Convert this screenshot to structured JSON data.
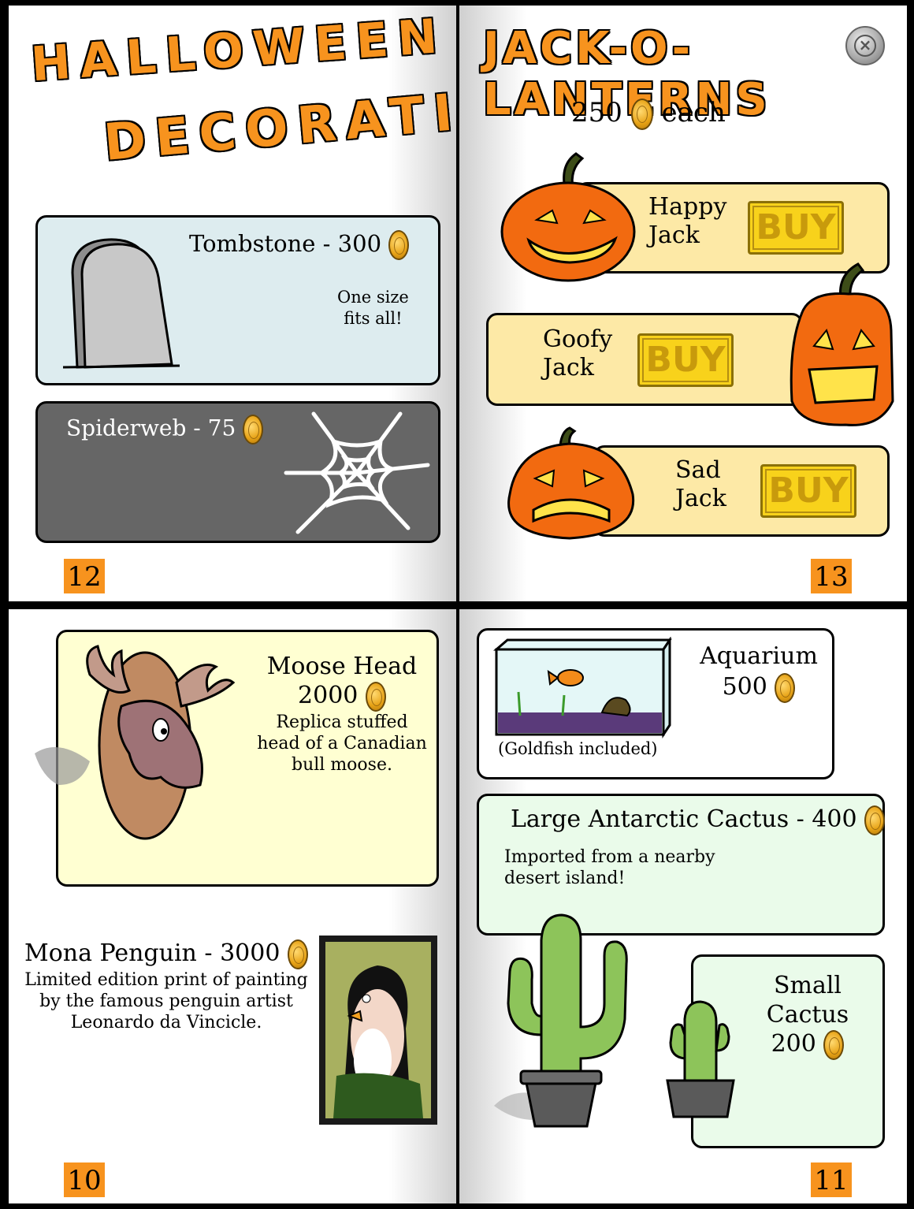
{
  "page12": {
    "title_line1": "HALLOWEEN",
    "title_line2": "DECORATIONS",
    "tombstone": {
      "name": "Tombstone - 300",
      "desc_line1": "One size",
      "desc_line2": "fits all!"
    },
    "spiderweb": {
      "name": "Spiderweb - 75"
    },
    "page_number": "12"
  },
  "page13": {
    "title": "JACK-O-LANTERNS",
    "price": "250",
    "price_suffix": "each",
    "items": [
      {
        "line1": "Happy",
        "line2": "Jack",
        "buy": "BUY"
      },
      {
        "line1": "Goofy",
        "line2": "Jack",
        "buy": "BUY"
      },
      {
        "line1": "Sad",
        "line2": "Jack",
        "buy": "BUY"
      }
    ],
    "page_number": "13"
  },
  "page10": {
    "moose": {
      "name": "Moose Head",
      "price": "2000",
      "desc_line1": "Replica stuffed",
      "desc_line2": "head of a Canadian",
      "desc_line3": "bull moose."
    },
    "mona": {
      "name": "Mona Penguin - 3000",
      "desc_line1": "Limited edition print of painting",
      "desc_line2": "by the famous penguin artist",
      "desc_line3": "Leonardo da Vincicle."
    },
    "page_number": "10"
  },
  "page11": {
    "aquarium": {
      "name": "Aquarium",
      "price": "500",
      "note": "(Goldfish included)"
    },
    "large_cactus": {
      "name": "Large Antarctic Cactus - 400",
      "desc_line1": "Imported from a nearby",
      "desc_line2": "desert island!"
    },
    "small_cactus": {
      "line1": "Small",
      "line2": "Cactus",
      "price": "200"
    },
    "page_number": "11"
  },
  "colors": {
    "accent": "#f7931e",
    "buy_bg": "#f8d21b",
    "jack_panel": "#fde9a6"
  },
  "icons": [
    "coin-icon",
    "close-icon",
    "tombstone-icon",
    "spiderweb-icon",
    "pumpkin-icon",
    "moose-head-icon",
    "painting-icon",
    "aquarium-icon",
    "cactus-icon"
  ]
}
